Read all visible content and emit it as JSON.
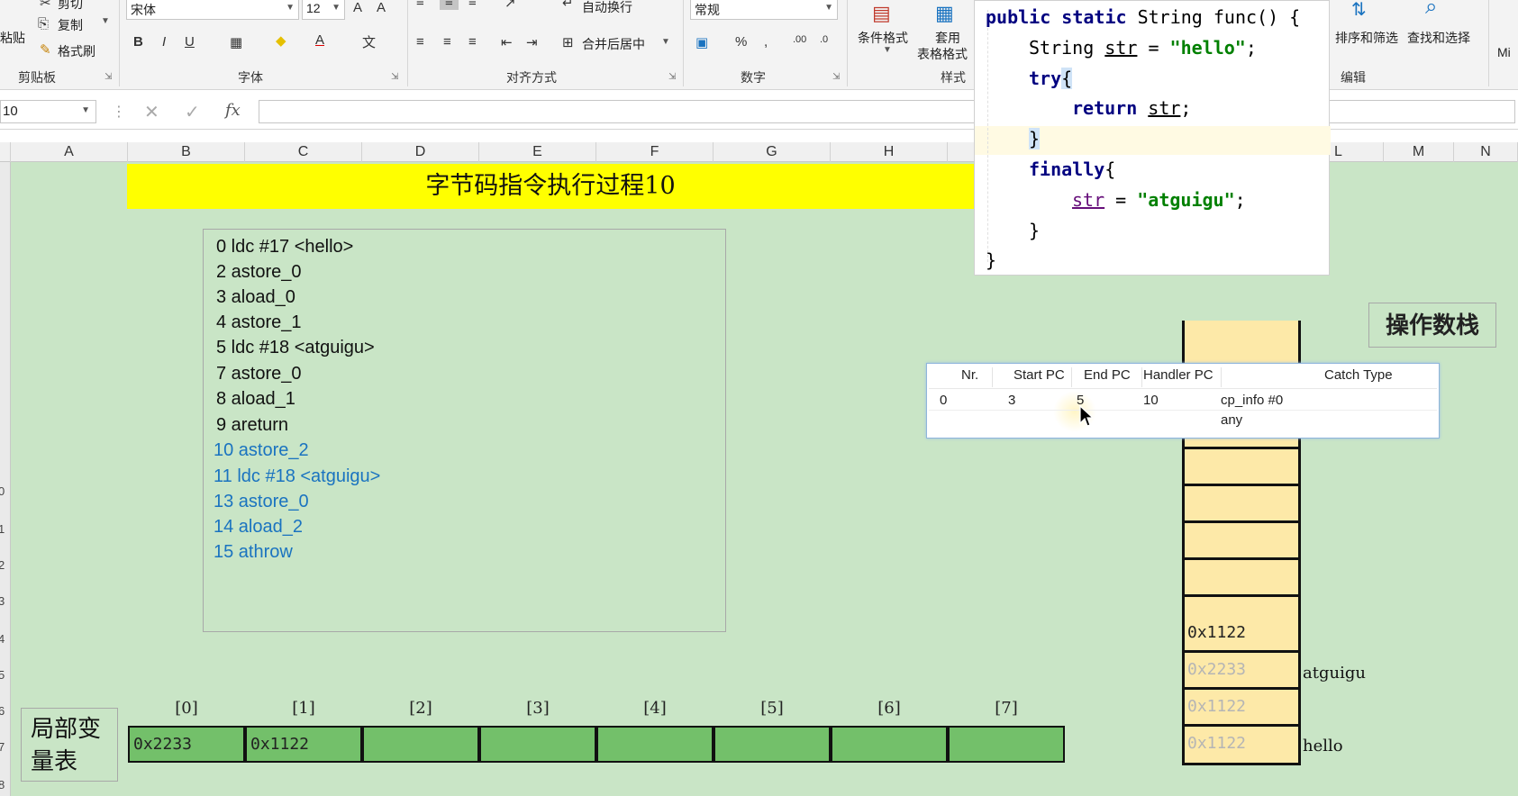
{
  "ribbon": {
    "clipboard": {
      "cut": "剪切",
      "copy": "复制",
      "format_painter": "格式刷",
      "paste": "粘贴",
      "label": "剪贴板"
    },
    "font": {
      "name": "宋体",
      "size": "12",
      "label": "字体"
    },
    "alignment": {
      "wrap_text": "自动换行",
      "merge_center": "合并后居中",
      "label": "对齐方式"
    },
    "number": {
      "format": "常规",
      "label": "数字"
    },
    "styles": {
      "conditional_format": "条件格式",
      "table_format_line1": "套用",
      "table_format_line2": "表格格式",
      "label": "样式"
    },
    "editing": {
      "sort_filter": "排序和筛选",
      "find_select": "查找和选择",
      "label": "编辑"
    },
    "extra": "Mi"
  },
  "formula_bar": {
    "name_box": "10",
    "fx": "fx"
  },
  "columns": [
    "A",
    "B",
    "C",
    "D",
    "E",
    "F",
    "G",
    "H",
    "L",
    "M",
    "N"
  ],
  "row_numbers": [
    "0",
    "1",
    "2",
    "3",
    "4",
    "5",
    "6",
    "7",
    "8"
  ],
  "title": "字节码指令执行过程10",
  "bytecode": [
    "0 ldc #17 <hello>",
    "2 astore_0",
    "3 aload_0",
    "4 astore_1",
    "5 ldc #18 <atguigu>",
    "7 astore_0",
    "8 aload_1",
    "9 areturn",
    "10 astore_2",
    "11 ldc #18 <atguigu>",
    "13 astore_0",
    "14 aload_2",
    "15 athrow"
  ],
  "code": {
    "l1_kw1": "public",
    "l1_kw2": "static",
    "l1_rest": " String func() {",
    "l2_a": "String ",
    "l2_var": "str",
    "l2_b": " = ",
    "l2_str": "\"hello\"",
    "l2_c": ";",
    "l3_kw": "try",
    "l3_b": "{",
    "l4_kw": "return",
    "l4_sp": " ",
    "l4_var": "str",
    "l4_c": ";",
    "l5": "}",
    "l6_kw": "finally",
    "l6_b": "{",
    "l7_var": "str",
    "l7_b": " = ",
    "l7_str": "\"atguigu\"",
    "l7_c": ";",
    "l8": "}",
    "l9": "}"
  },
  "stack": {
    "title": "操作数栈",
    "cells": [
      {
        "value": "0x1122",
        "faded": false
      },
      {
        "value": "0x2233",
        "faded": true
      },
      {
        "value": "0x1122",
        "faded": true
      },
      {
        "value": "0x1122",
        "faded": true
      }
    ],
    "labels": [
      "atguigu",
      "hello"
    ]
  },
  "exception_table": {
    "headers": [
      "Nr.",
      "Start PC",
      "End PC",
      "Handler PC",
      "Catch Type"
    ],
    "row": [
      "0",
      "3",
      "5",
      "10",
      "cp_info #0"
    ],
    "catch_type_sub": "any"
  },
  "local_vars": {
    "label_line1": "局部变",
    "label_line2": "量表",
    "indices": [
      "[0]",
      "[1]",
      "[2]",
      "[3]",
      "[4]",
      "[5]",
      "[6]",
      "[7]"
    ],
    "values": [
      "0x2233",
      "0x1122",
      "",
      "",
      "",
      "",
      "",
      ""
    ]
  },
  "colors": {
    "sheet_bg": "#c9e5c6",
    "title_bg": "#ffff00",
    "stack_bg": "#fde9a8",
    "lvt_cell": "#73c06a",
    "highlight_text": "#1a73c0"
  }
}
